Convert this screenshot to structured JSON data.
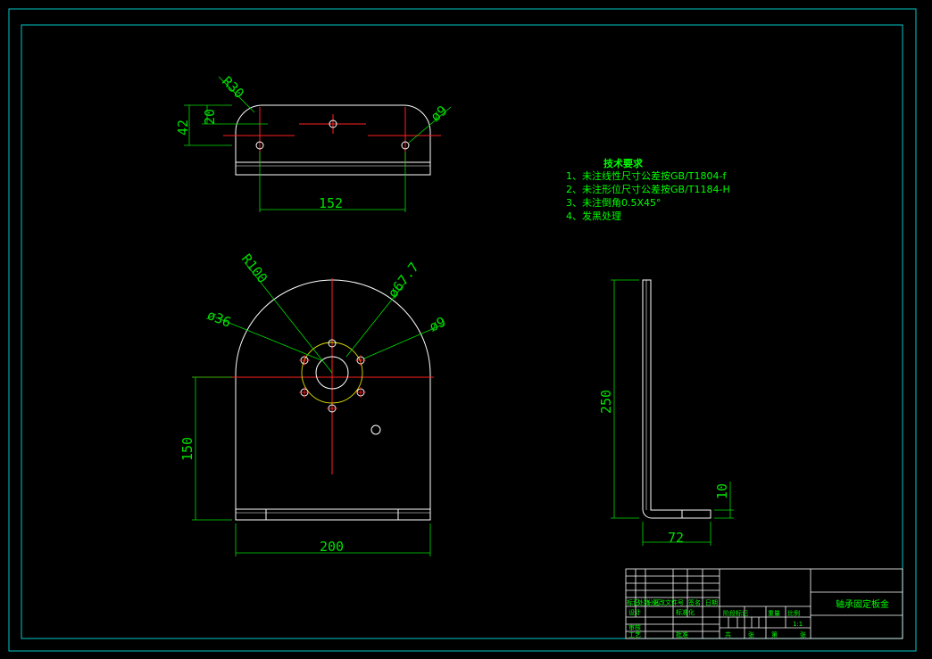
{
  "colors": {
    "background": "#000000",
    "outline": "#ffffff",
    "dimension": "#00e000",
    "centerline": "#ff2020",
    "frame": "#00c8c8",
    "pcd_circle": "#e0e000",
    "text": "#00ff00"
  },
  "top_view": {
    "dim_radius": "R30",
    "dim_height_small": "20",
    "dim_height_total": "42",
    "dim_hole": "ø9",
    "dim_width": "152"
  },
  "front_view": {
    "dim_radius": "R100",
    "dim_bore": "ø36",
    "dim_pcd": "ø67.7",
    "dim_hole": "ø9",
    "dim_height": "150",
    "dim_width": "200"
  },
  "side_view": {
    "dim_height": "250",
    "dim_thickness": "10",
    "dim_leg": "72"
  },
  "tech_requirements": {
    "title": "技术要求",
    "items": [
      "1、未注线性尺寸公差按GB/T1804-f",
      "2、未注形位尺寸公差按GB/T1184-H",
      "3、未注倒角0.5X45°",
      "4、发黑处理"
    ]
  },
  "title_block": {
    "part_name": "轴承固定板金",
    "scale": "1:1",
    "labels": {
      "mark": "标记",
      "count": "处数",
      "zone": "分区",
      "change_doc": "更改文件号",
      "signature": "签名",
      "date": "日期",
      "design": "设计",
      "standardize": "标准化",
      "stage_mark": "阶段标记",
      "weight": "重量",
      "ratio": "比例",
      "review": "审核",
      "process": "工艺",
      "approve": "批准",
      "total": "共",
      "sheet": "张",
      "page": "第"
    }
  }
}
